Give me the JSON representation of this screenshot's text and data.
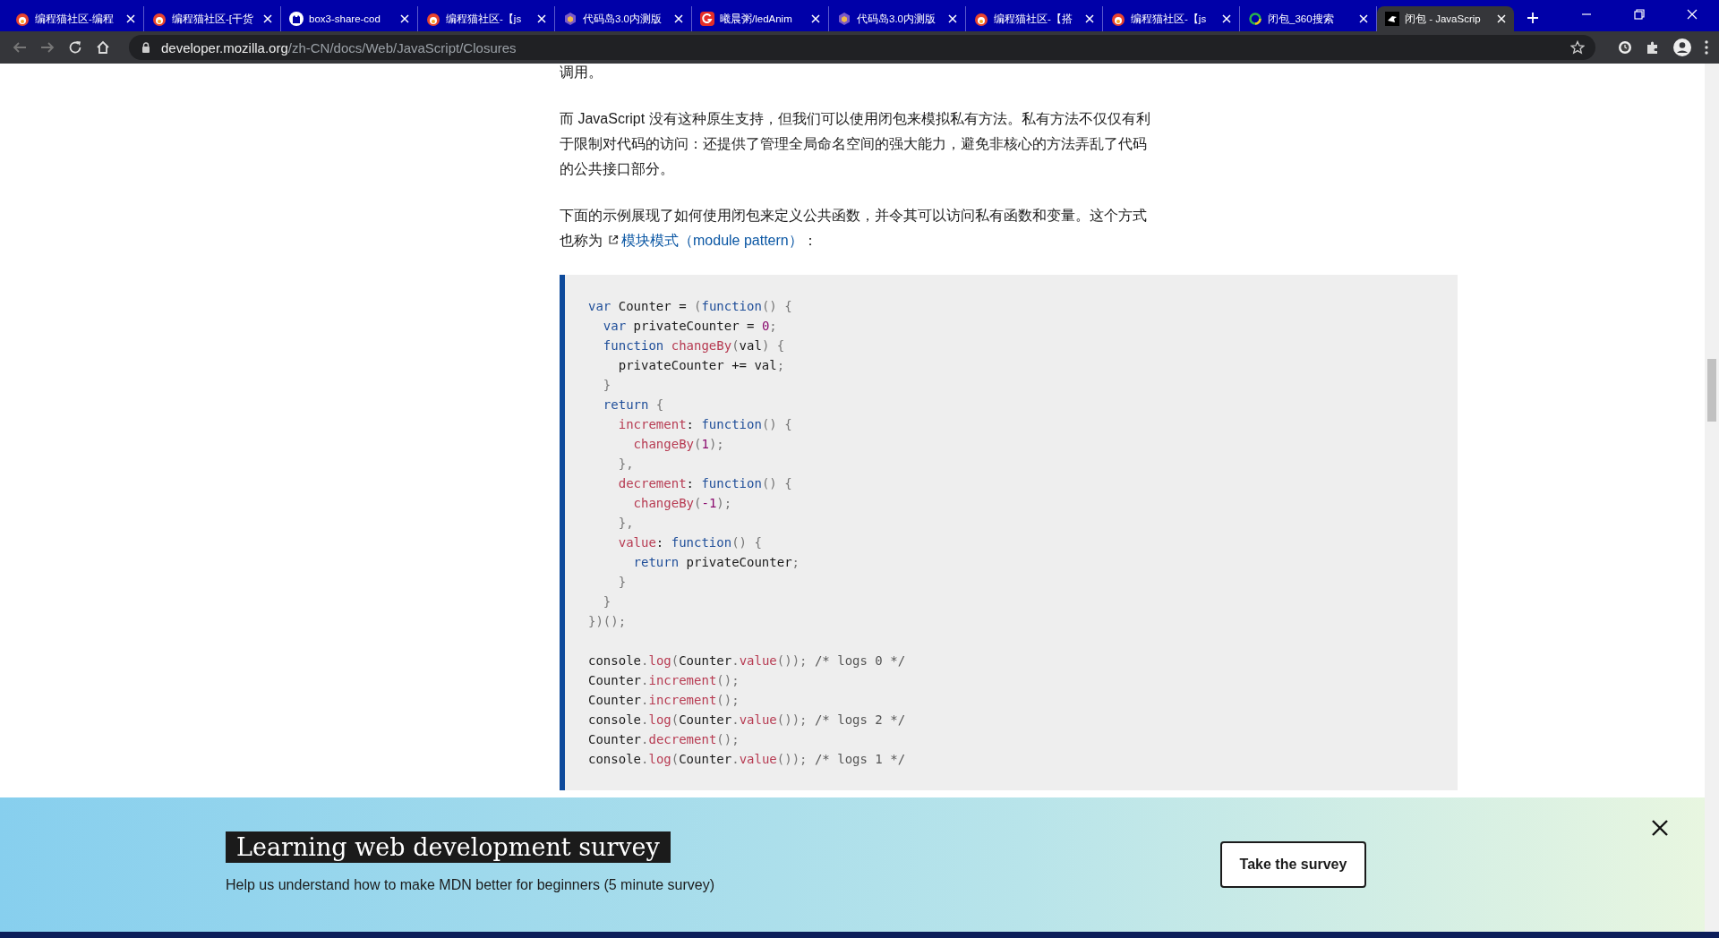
{
  "browser": {
    "tabs": [
      {
        "title": "编程猫社区-编程",
        "kind": "mascot",
        "selected": false
      },
      {
        "title": "编程猫社区-[干货",
        "kind": "mascot",
        "selected": false
      },
      {
        "title": "box3-share-cod",
        "kind": "octocat",
        "selected": false
      },
      {
        "title": "编程猫社区-【js",
        "kind": "mascot",
        "selected": false
      },
      {
        "title": "代码岛3.0内测版",
        "kind": "hexagon",
        "selected": false
      },
      {
        "title": "曦晨粥/ledAnim",
        "kind": "gitee",
        "selected": false
      },
      {
        "title": "代码岛3.0内测版",
        "kind": "hexagon",
        "selected": false
      },
      {
        "title": "编程猫社区-【搭",
        "kind": "mascot",
        "selected": false
      },
      {
        "title": "编程猫社区-【js",
        "kind": "mascot",
        "selected": false
      },
      {
        "title": "闭包_360搜索",
        "kind": "ring",
        "selected": false
      },
      {
        "title": "闭包 - JavaScrip",
        "kind": "mdn",
        "selected": true
      }
    ],
    "address": {
      "host": "developer.mozilla.org",
      "path": "/zh-CN/docs/Web/JavaScript/Closures"
    }
  },
  "article": {
    "paragraphs": [
      {
        "text": "调用。"
      },
      {
        "text": "而 JavaScript 没有这种原生支持，但我们可以使用闭包来模拟私有方法。私有方法不仅仅有利于限制对代码的访问：还提供了管理全局命名空间的强大能力，避免非核心的方法弄乱了代码的公共接口部分。"
      },
      {
        "text": "下面的示例展现了如何使用闭包来定义公共函数，并令其可以访问私有函数和变量。这个方式也称为",
        "link": "模块模式（module pattern）",
        "after": "："
      }
    ],
    "code": [
      [
        [
          {
            "kind": "keyword",
            "text": "var"
          },
          {
            "kind": "plain",
            "text": " Counter = "
          },
          {
            "kind": "punct",
            "text": "("
          },
          {
            "kind": "keyword",
            "text": "function"
          },
          {
            "kind": "punct",
            "text": "() {"
          }
        ],
        [
          {
            "kind": "keyword",
            "text": "  var"
          },
          {
            "kind": "plain",
            "text": " privateCounter = "
          },
          {
            "kind": "number",
            "text": "0"
          },
          {
            "kind": "punct",
            "text": ";"
          }
        ],
        [
          {
            "kind": "keyword",
            "text": "  function "
          },
          {
            "kind": "name",
            "text": "changeBy"
          },
          {
            "kind": "punct",
            "text": "("
          },
          {
            "kind": "plain",
            "text": "val"
          },
          {
            "kind": "punct",
            "text": ") {"
          }
        ],
        [
          {
            "kind": "plain",
            "text": "    privateCounter += val"
          },
          {
            "kind": "punct",
            "text": ";"
          }
        ],
        [
          {
            "kind": "punct",
            "text": "  }"
          }
        ],
        [
          {
            "kind": "keyword",
            "text": "  return "
          },
          {
            "kind": "punct",
            "text": "{"
          }
        ],
        [
          {
            "kind": "name",
            "text": "    increment"
          },
          {
            "kind": "plain",
            "text": ": "
          },
          {
            "kind": "keyword",
            "text": "function"
          },
          {
            "kind": "punct",
            "text": "() {"
          }
        ],
        [
          {
            "kind": "name",
            "text": "      changeBy"
          },
          {
            "kind": "punct",
            "text": "("
          },
          {
            "kind": "number",
            "text": "1"
          },
          {
            "kind": "punct",
            "text": ");"
          }
        ],
        [
          {
            "kind": "punct",
            "text": "    },"
          }
        ],
        [
          {
            "kind": "name",
            "text": "    decrement"
          },
          {
            "kind": "plain",
            "text": ": "
          },
          {
            "kind": "keyword",
            "text": "function"
          },
          {
            "kind": "punct",
            "text": "() {"
          }
        ],
        [
          {
            "kind": "name",
            "text": "      changeBy"
          },
          {
            "kind": "punct",
            "text": "("
          },
          {
            "kind": "number",
            "text": "-1"
          },
          {
            "kind": "punct",
            "text": ");"
          }
        ],
        [
          {
            "kind": "punct",
            "text": "    },"
          }
        ],
        [
          {
            "kind": "name",
            "text": "    value"
          },
          {
            "kind": "plain",
            "text": ": "
          },
          {
            "kind": "keyword",
            "text": "function"
          },
          {
            "kind": "punct",
            "text": "() {"
          }
        ],
        [
          {
            "kind": "keyword",
            "text": "      return"
          },
          {
            "kind": "plain",
            "text": " privateCounter"
          },
          {
            "kind": "punct",
            "text": ";"
          }
        ],
        [
          {
            "kind": "punct",
            "text": "    }"
          }
        ],
        [
          {
            "kind": "punct",
            "text": "  }"
          }
        ],
        [
          {
            "kind": "punct",
            "text": "})();"
          }
        ]
      ],
      [
        [
          {
            "kind": "plain",
            "text": "console"
          },
          {
            "kind": "punct",
            "text": "."
          },
          {
            "kind": "name",
            "text": "log"
          },
          {
            "kind": "punct",
            "text": "("
          },
          {
            "kind": "plain",
            "text": "Counter"
          },
          {
            "kind": "punct",
            "text": "."
          },
          {
            "kind": "name",
            "text": "value"
          },
          {
            "kind": "punct",
            "text": "());"
          },
          {
            "kind": "comment",
            "text": " /* logs 0 */"
          }
        ],
        [
          {
            "kind": "plain",
            "text": "Counter"
          },
          {
            "kind": "punct",
            "text": "."
          },
          {
            "kind": "name",
            "text": "increment"
          },
          {
            "kind": "punct",
            "text": "();"
          }
        ],
        [
          {
            "kind": "plain",
            "text": "Counter"
          },
          {
            "kind": "punct",
            "text": "."
          },
          {
            "kind": "name",
            "text": "increment"
          },
          {
            "kind": "punct",
            "text": "();"
          }
        ],
        [
          {
            "kind": "plain",
            "text": "console"
          },
          {
            "kind": "punct",
            "text": "."
          },
          {
            "kind": "name",
            "text": "log"
          },
          {
            "kind": "punct",
            "text": "("
          },
          {
            "kind": "plain",
            "text": "Counter"
          },
          {
            "kind": "punct",
            "text": "."
          },
          {
            "kind": "name",
            "text": "value"
          },
          {
            "kind": "punct",
            "text": "());"
          },
          {
            "kind": "comment",
            "text": " /* logs 2 */"
          }
        ],
        [
          {
            "kind": "plain",
            "text": "Counter"
          },
          {
            "kind": "punct",
            "text": "."
          },
          {
            "kind": "name",
            "text": "decrement"
          },
          {
            "kind": "punct",
            "text": "();"
          }
        ],
        [
          {
            "kind": "plain",
            "text": "console"
          },
          {
            "kind": "punct",
            "text": "."
          },
          {
            "kind": "name",
            "text": "log"
          },
          {
            "kind": "punct",
            "text": "("
          },
          {
            "kind": "plain",
            "text": "Counter"
          },
          {
            "kind": "punct",
            "text": "."
          },
          {
            "kind": "name",
            "text": "value"
          },
          {
            "kind": "punct",
            "text": "());"
          },
          {
            "kind": "comment",
            "text": " /* logs 1 */"
          }
        ]
      ]
    ]
  },
  "banner": {
    "title": "Learning web development survey",
    "text": "Help us understand how to make MDN better for beginners (5 minute survey)",
    "button": "Take the survey"
  }
}
